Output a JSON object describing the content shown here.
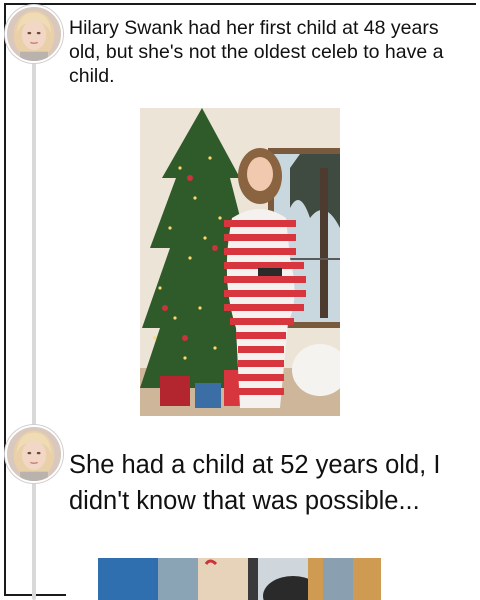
{
  "thread": {
    "posts": [
      {
        "avatar_icon": "avatar-user-icon",
        "text": "Hilary Swank had her first child at 48 years old, but she's not the oldest celeb to have a child.",
        "image_desc": "pregnant-woman-christmas-tree-photo"
      },
      {
        "avatar_icon": "avatar-user-icon",
        "text": "She had a child at 52 years old, I didn't know that was possible...",
        "image_desc": "partial-photo"
      }
    ]
  },
  "colors": {
    "frame": "#1a1a1a",
    "rail": "#d9d9d9",
    "text": "#111111",
    "stripe_red": "#d8363e",
    "tree_green": "#2f5a2a"
  }
}
